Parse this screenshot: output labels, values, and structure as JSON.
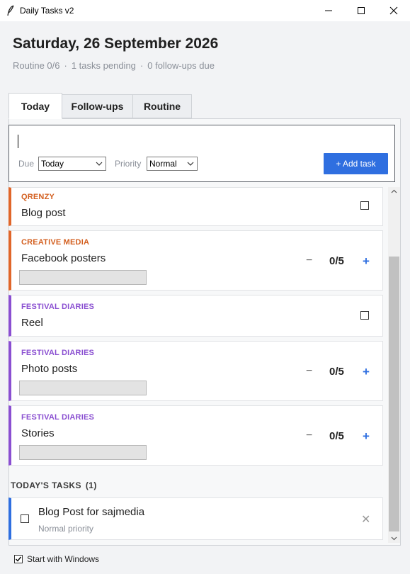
{
  "window": {
    "title": "Daily Tasks v2"
  },
  "header": {
    "date": "Saturday, 26 September 2026",
    "summary": [
      "Routine 0/6",
      "1 tasks pending",
      "0 follow-ups due"
    ],
    "separator": "·"
  },
  "tabs": [
    {
      "label": "Today",
      "active": true
    },
    {
      "label": "Follow-ups",
      "active": false
    },
    {
      "label": "Routine",
      "active": false
    }
  ],
  "entry": {
    "due_label": "Due",
    "due_value": "Today",
    "priority_label": "Priority",
    "priority_value": "Normal",
    "add_button": "+ Add task"
  },
  "routine": [
    {
      "category": "QRENZY",
      "name": "Blog post",
      "kind": "check",
      "color": "#e0662a"
    },
    {
      "category": "CREATIVE MEDIA",
      "name": "Facebook posters",
      "kind": "counter",
      "done": 0,
      "total": 5,
      "count_label": "0/5",
      "color": "#e0662a"
    },
    {
      "category": "FESTIVAL DIARIES",
      "name": "Reel",
      "kind": "check",
      "color": "#8a4fd1"
    },
    {
      "category": "FESTIVAL DIARIES",
      "name": "Photo posts",
      "kind": "counter",
      "done": 0,
      "total": 5,
      "count_label": "0/5",
      "color": "#8a4fd1"
    },
    {
      "category": "FESTIVAL DIARIES",
      "name": "Stories",
      "kind": "counter",
      "done": 0,
      "total": 5,
      "count_label": "0/5",
      "color": "#8a4fd1"
    }
  ],
  "counter_minus": "−",
  "counter_plus": "+",
  "todays_tasks": {
    "title": "TODAY'S TASKS",
    "count": "(1)",
    "items": [
      {
        "name": "Blog Post for sajmedia",
        "priority": "Normal priority",
        "delete": "✕",
        "accent": "#2f6fe0"
      }
    ]
  },
  "footer": {
    "start_with_windows": "Start with Windows",
    "checked": true
  }
}
